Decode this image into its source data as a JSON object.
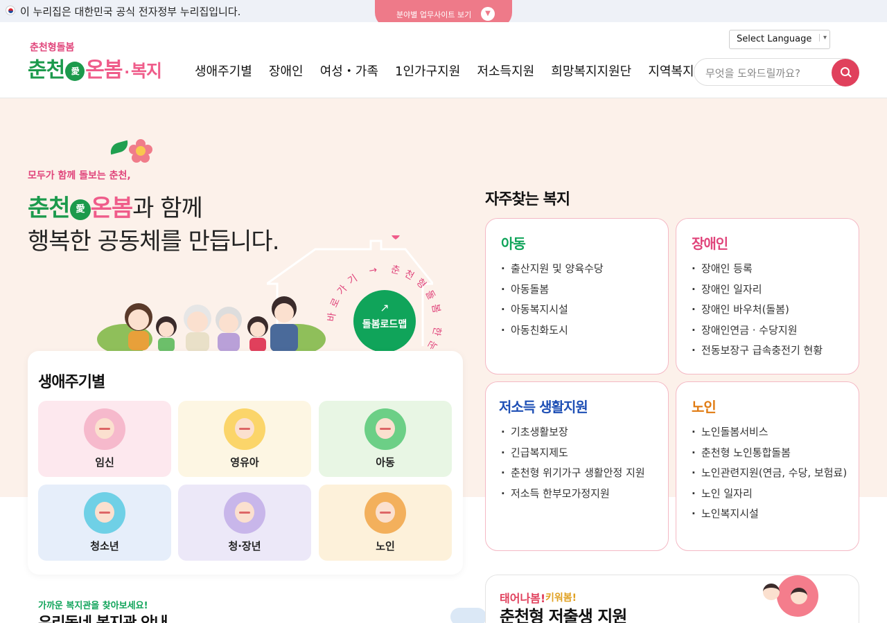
{
  "gov_banner": {
    "text": "이 누리집은 대한민국 공식 전자정부 누리집입니다.",
    "field_sites_label": "분야별 업무사이트 보기"
  },
  "logo": {
    "sub": "춘천형돌봄",
    "main_part1": "춘천",
    "heart_text": "愛",
    "main_part2": "온",
    "main_part3": "봄",
    "dot": "·",
    "welfare": "복지"
  },
  "nav": {
    "items": [
      "생애주기별",
      "장애인",
      "여성・가족",
      "1인가구지원",
      "저소득지원",
      "희망복지지원단",
      "지역복지"
    ]
  },
  "language": {
    "label": "Select Language",
    "caret": "▾"
  },
  "search": {
    "placeholder": "무엇을 도와드릴까요?"
  },
  "hero": {
    "subtitle": "모두가 함께 돌보는 춘천,",
    "brand_part1": "춘천",
    "brand_heart": "愛",
    "brand_part2": "온",
    "brand_part3": "봄",
    "title_line1_suffix": "과 함께",
    "title_line2": "행복한 공동체를 만듭니다.",
    "roadmap_arrow": "↗",
    "roadmap_label": "돌봄로드맵",
    "arc_text": "바로가기 → 춘천형돌봄 한눈에 몸록"
  },
  "life_cycle": {
    "title": "생애주기별",
    "items": [
      {
        "label": "임신"
      },
      {
        "label": "영유아"
      },
      {
        "label": "아동"
      },
      {
        "label": "청소년"
      },
      {
        "label": "청·장년"
      },
      {
        "label": "노인"
      }
    ]
  },
  "frequent": {
    "title": "자주찾는 복지",
    "cards": [
      {
        "title": "아동",
        "color": "#10a45a",
        "items": [
          "출산지원 및 양육수당",
          "아동돌봄",
          "아동복지시설",
          "아동친화도시"
        ]
      },
      {
        "title": "장애인",
        "color": "#e0457b",
        "items": [
          "장애인 등록",
          "장애인 일자리",
          "장애인 바우처(돌봄)",
          "장애인연금 · 수당지원",
          "전동보장구 급속충전기 현황"
        ]
      },
      {
        "title": "저소득 생활지원",
        "color": "#1e4fb5",
        "items": [
          "기초생활보장",
          "긴급복지제도",
          "춘천형 위기가구 생활안정 지원",
          "저소득 한부모가정지원"
        ]
      },
      {
        "title": "노인",
        "color": "#e07b12",
        "items": [
          "노인돌봄서비스",
          "춘천형 노인통합돌봄",
          "노인관련지원(연금, 수당, 보험료)",
          "노인 일자리",
          "노인복지시설"
        ]
      }
    ]
  },
  "nearby": {
    "subtitle": "가까운 복지관을 찾아보세요!",
    "title": "우리동네 복지관 안내"
  },
  "birth_support": {
    "tag1": "태어나봄!",
    "tag2": "키워봄!",
    "title": "춘천형 저출생 지원"
  }
}
